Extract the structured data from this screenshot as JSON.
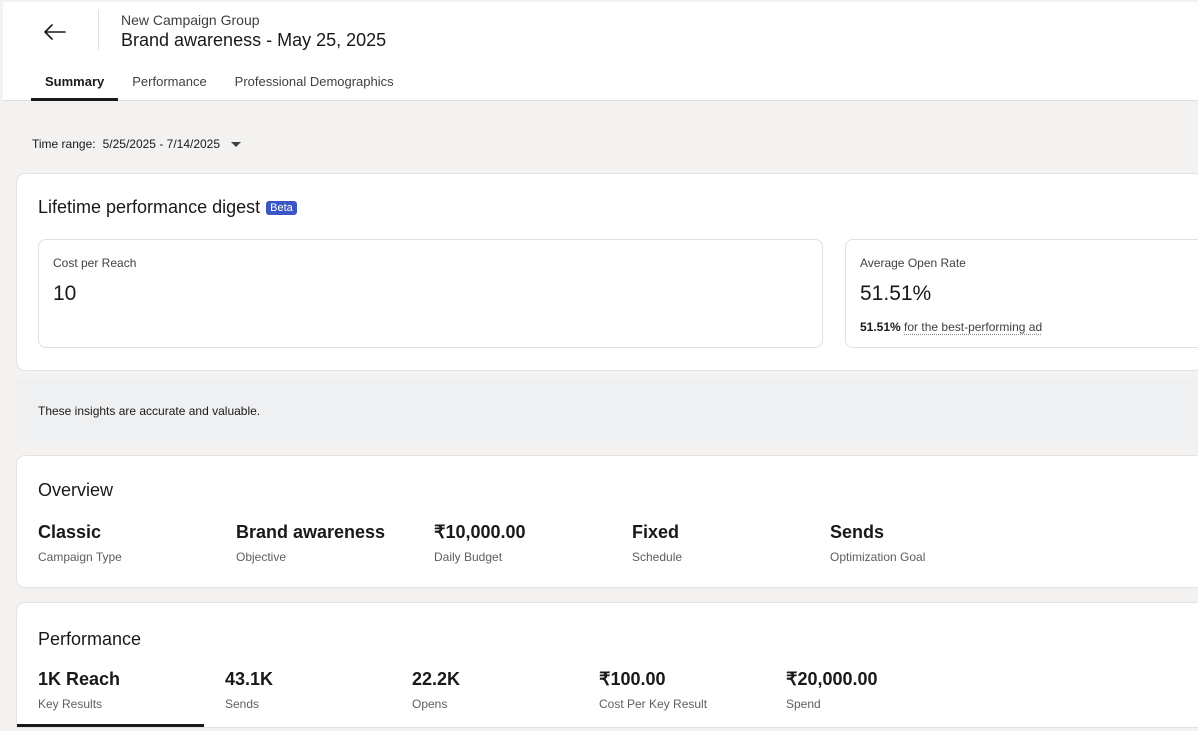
{
  "header": {
    "back_icon": "arrow-left-icon",
    "subtitle": "New Campaign Group",
    "title": "Brand awareness - May 25, 2025",
    "tabs": [
      {
        "label": "Summary",
        "active": true
      },
      {
        "label": "Performance",
        "active": false
      },
      {
        "label": "Professional Demographics",
        "active": false
      }
    ]
  },
  "time_range": {
    "label": "Time range:",
    "value": "5/25/2025 - 7/14/2025",
    "icon": "caret-down-icon"
  },
  "digest": {
    "title": "Lifetime performance digest",
    "badge": "Beta",
    "badge_color": "#3a56c5",
    "metrics": [
      {
        "label": "Cost per Reach",
        "value": "10"
      },
      {
        "label": "Average Open Rate",
        "value": "51.51%",
        "note_value": "51.51%",
        "note_text": "for the best-performing ad"
      }
    ]
  },
  "insight": {
    "text": "These insights are accurate and valuable."
  },
  "overview": {
    "title": "Overview",
    "items": [
      {
        "value": "Classic",
        "label": "Campaign Type"
      },
      {
        "value": "Brand awareness",
        "label": "Objective"
      },
      {
        "value": "₹10,000.00",
        "label": "Daily Budget"
      },
      {
        "value": "Fixed",
        "label": "Schedule"
      },
      {
        "value": "Sends",
        "label": "Optimization Goal"
      }
    ]
  },
  "performance": {
    "title": "Performance",
    "items": [
      {
        "value": "1K Reach",
        "label": "Key Results",
        "active": true
      },
      {
        "value": "43.1K",
        "label": "Sends"
      },
      {
        "value": "22.2K",
        "label": "Opens"
      },
      {
        "value": "₹100.00",
        "label": "Cost Per Key Result"
      },
      {
        "value": "₹20,000.00",
        "label": "Spend"
      }
    ]
  }
}
